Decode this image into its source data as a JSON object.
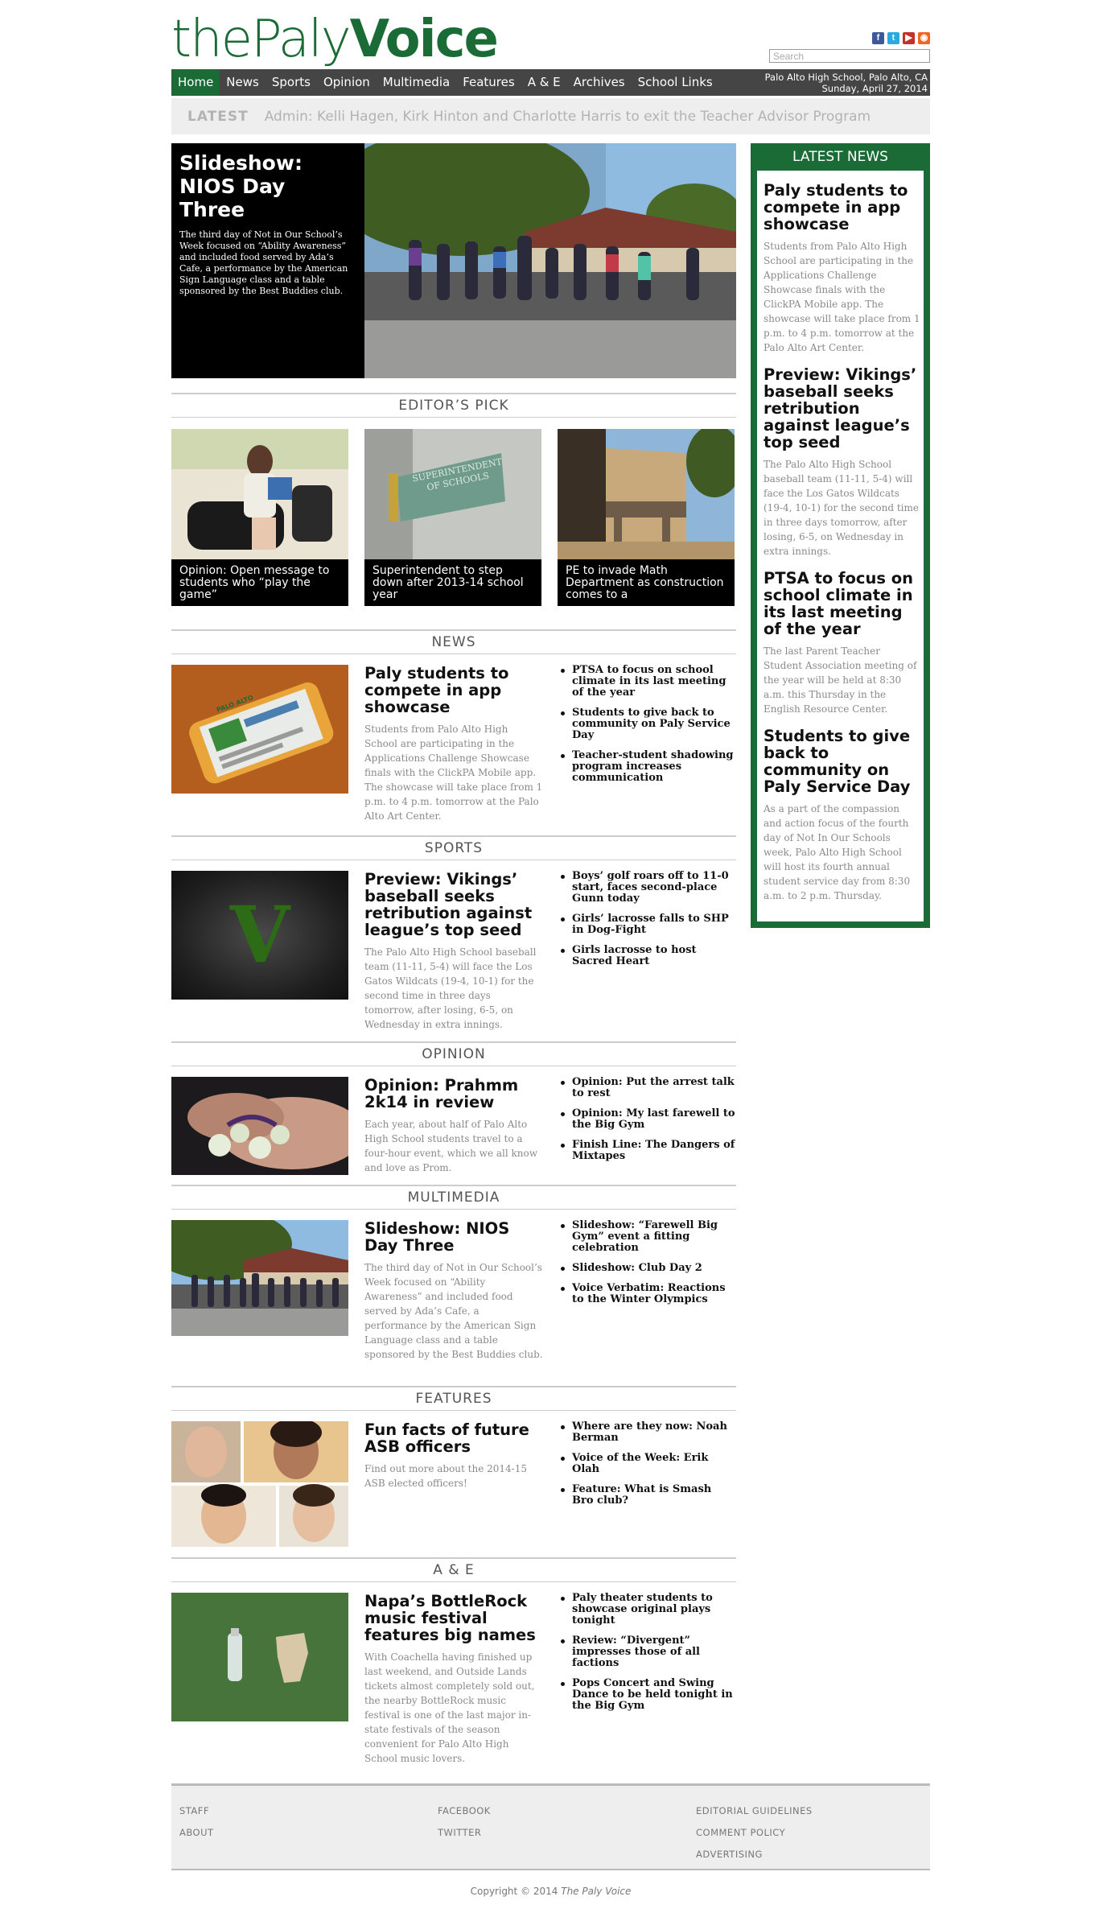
{
  "header": {
    "logo_part1": "the",
    "logo_part2": "Paly",
    "logo_part3": "Voice",
    "search_placeholder": "Search",
    "social": [
      "facebook-icon",
      "twitter-icon",
      "youtube-icon",
      "rss-icon"
    ],
    "location": "Palo Alto High School, Palo Alto, CA",
    "date": "Sunday, April 27, 2014"
  },
  "nav": {
    "items": [
      "Home",
      "News",
      "Sports",
      "Opinion",
      "Multimedia",
      "Features",
      "A & E",
      "Archives",
      "School Links"
    ],
    "active": "Home"
  },
  "ticker": {
    "label": "LATEST",
    "text": "Admin: Kelli Hagen, Kirk Hinton and Charlotte Harris to exit the Teacher Advisor Program"
  },
  "slideshow": {
    "title": "Slideshow: NIOS Day Three",
    "text": "The third day of Not in Our School’s Week focused on “Ability Awareness” and included food served by Ada’s Cafe, a performance by the American Sign Language class and a table sponsored by the Best Buddies club."
  },
  "sections": {
    "editors_pick": "EDITOR’S PICK",
    "news": "NEWS",
    "sports": "SPORTS",
    "opinion": "OPINION",
    "multimedia": "MULTIMEDIA",
    "features": "FEATURES",
    "ae": "A & E"
  },
  "editors_picks": [
    {
      "caption": "Opinion: Open message to students who “play the game”"
    },
    {
      "caption": "Superintendent to step down after 2013-14 school year",
      "sign_text": "SUPERINTENDENT OF SCHOOLS"
    },
    {
      "caption": "PE to invade Math Department as construction comes to a"
    }
  ],
  "news": {
    "title": "Paly students to compete in app showcase",
    "text": "Students from Palo Alto High School are participating in the Applications Challenge Showcase finals with the ClickPA Mobile app. The showcase will take place from 1 p.m. to 4 p.m. tomorrow at the Palo Alto Art Center.",
    "phone_text": "PALO ALTO",
    "links": [
      "PTSA to focus on school climate in its last meeting of the year",
      "Students to give back to community on Paly Service Day",
      "Teacher-student shadowing program increases communication"
    ]
  },
  "sports": {
    "title": "Preview: Vikings’ baseball seeks retribution against league’s top seed",
    "text": "The Palo Alto High School baseball team (11-11, 5-4) will face the Los Gatos Wildcats (19-4, 10-1) for the second time in three days tomorrow, after losing, 6-5, on Wednesday in extra innings.",
    "logo_letter": "V",
    "links": [
      "Boys’ golf roars off to 11-0 start, faces second-place Gunn today",
      "Girls’ lacrosse falls to SHP in Dog-Fight",
      "Girls lacrosse to host Sacred Heart"
    ]
  },
  "opinion": {
    "title": "Opinion: Prahmm 2k14 in review",
    "text": "Each year, about half of Palo Alto High School students travel to a four-hour event, which we all know and love as Prom.",
    "links": [
      "Opinion: Put the arrest talk to rest",
      "Opinion: My last farewell to the Big Gym",
      "Finish Line: The Dangers of Mixtapes"
    ]
  },
  "multimedia": {
    "title": "Slideshow: NIOS Day Three",
    "text": "The third day of Not in Our School’s Week focused on “Ability Awareness” and included food served by Ada’s Cafe, a performance by the American Sign Language class and a table sponsored by the Best Buddies club.",
    "links": [
      "Slideshow: “Farewell Big Gym” event a fitting celebration",
      "Slideshow: Club Day 2",
      "Voice Verbatim: Reactions to the Winter Olympics"
    ]
  },
  "features": {
    "title": "Fun facts of future ASB officers",
    "text": "Find out more about the 2014-15 ASB elected officers!",
    "links": [
      "Where are they now: Noah Berman",
      "Voice of the Week: Erik Olah",
      "Feature: What is Smash Bro club?"
    ]
  },
  "ae": {
    "title": "Napa’s BottleRock music festival features big names",
    "text": "With Coachella having finished up last weekend, and Outside Lands tickets almost completely sold out, the nearby BottleRock music festival is one of the last major in-state festivals of the season convenient for Palo Alto High School music lovers.",
    "links": [
      "Paly theater students to showcase original plays tonight",
      "Review: “Divergent” impresses those of all factions",
      "Pops Concert and Swing Dance to be held tonight in the Big Gym"
    ]
  },
  "sidebar": {
    "heading": "LATEST NEWS",
    "items": [
      {
        "title": "Paly students to compete in app showcase",
        "text": "Students from Palo Alto High School are participating in the Applications Challenge Showcase finals with the ClickPA Mobile app. The showcase will take place from 1 p.m. to 4 p.m. tomorrow at the Palo Alto Art Center."
      },
      {
        "title": "Preview: Vikings’ baseball seeks retribution against league’s top seed",
        "text": "The Palo Alto High School baseball team (11-11, 5-4) will face the Los Gatos Wildcats (19-4, 10-1) for the second time in three days tomorrow, after losing, 6-5, on Wednesday in extra innings."
      },
      {
        "title": "PTSA to focus on school climate in its last meeting of the year",
        "text": "The last Parent Teacher Student Association meeting of the year will be held at 8:30 a.m. this Thursday in the English Resource Center."
      },
      {
        "title": "Students to give back to community on Paly Service Day",
        "text": "As a part of the compassion and action focus of the fourth day of Not In Our Schools week, Palo Alto High School will host its fourth annual student service day from 8:30 a.m. to 2 p.m. Thursday."
      }
    ]
  },
  "footer": {
    "col1": [
      "STAFF",
      "ABOUT"
    ],
    "col2": [
      "FACEBOOK",
      "TWITTER"
    ],
    "col3": [
      "EDITORIAL GUIDELINES",
      "COMMENT POLICY",
      "ADVERTISING"
    ],
    "copyright": "Copyright © 2014",
    "copyright_name": "The Paly Voice"
  }
}
